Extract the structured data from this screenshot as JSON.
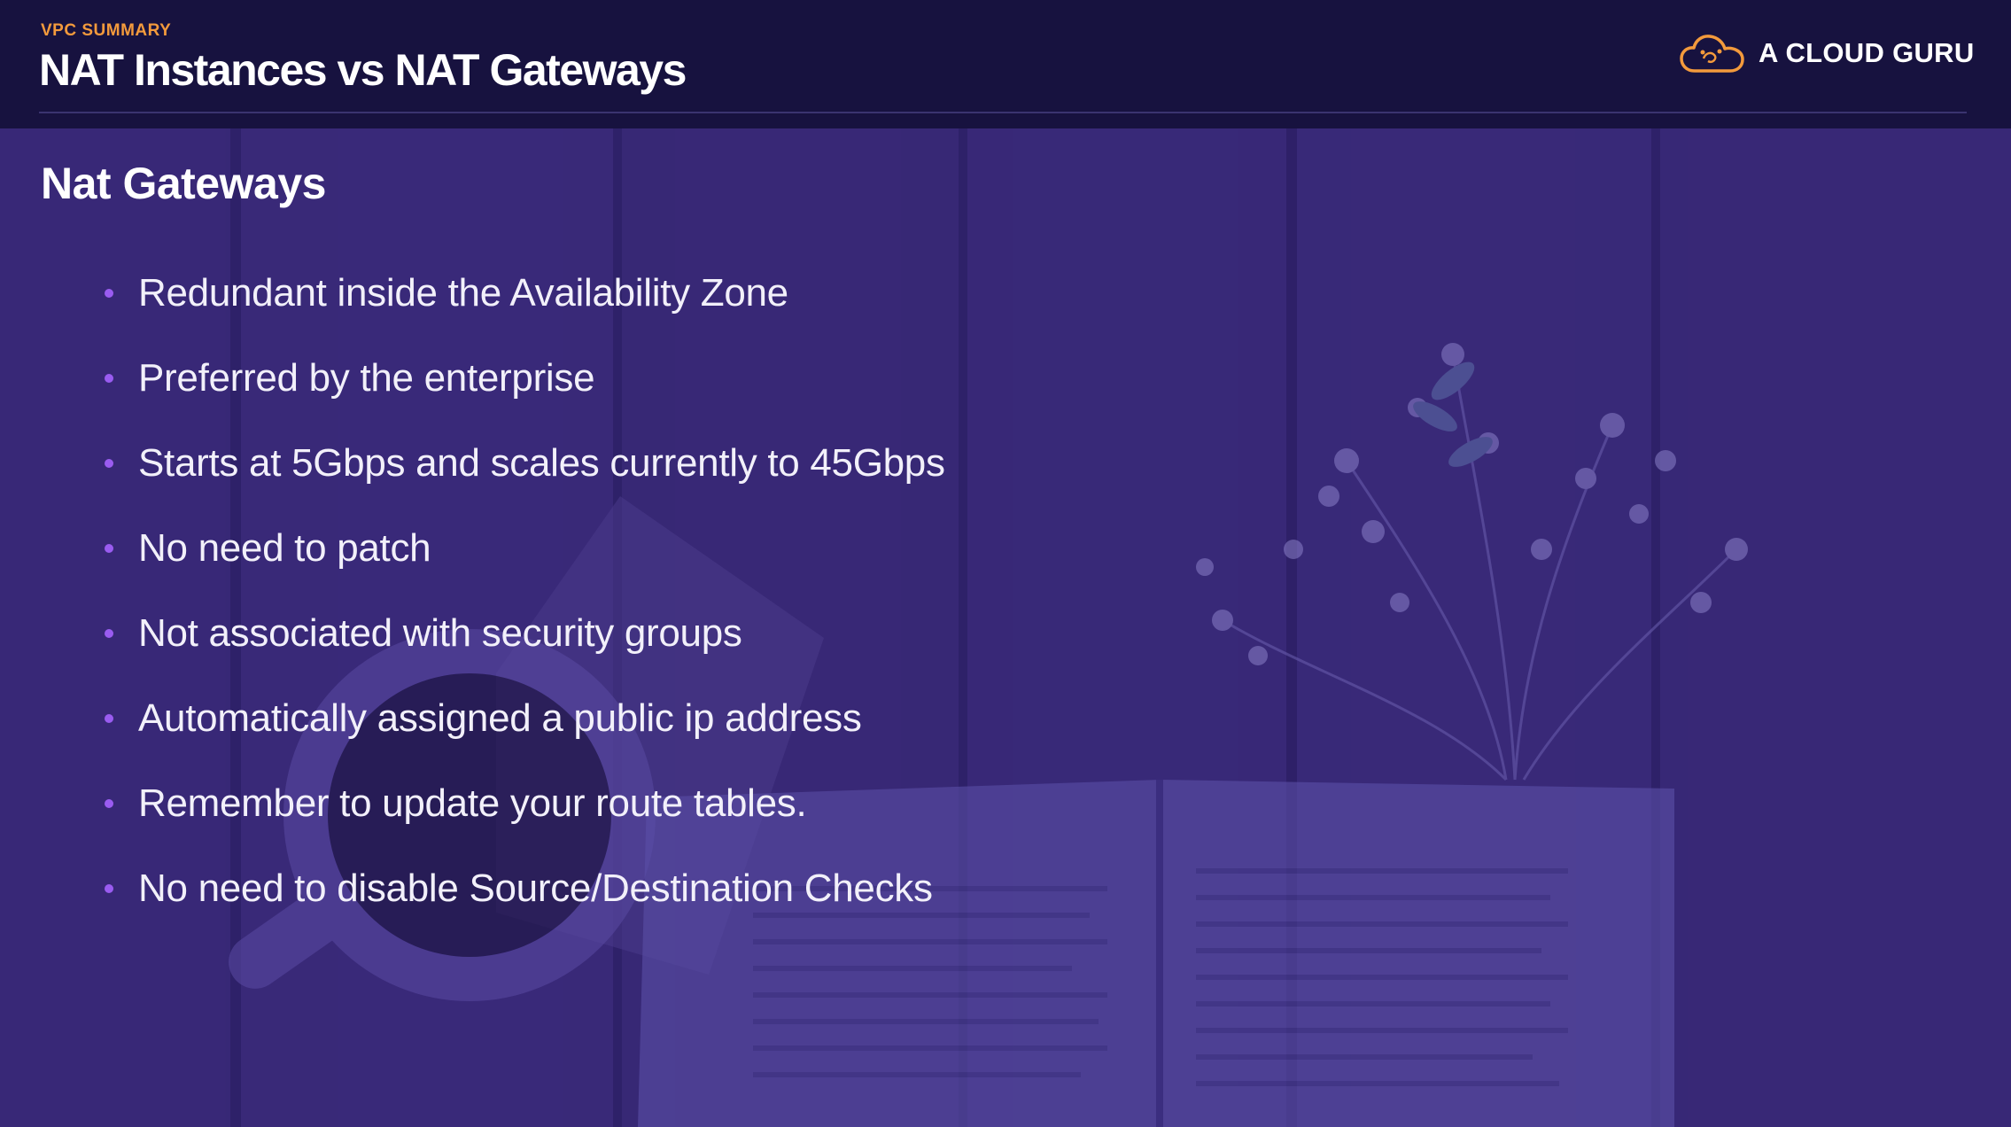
{
  "header": {
    "eyebrow": "VPC SUMMARY",
    "title": "NAT Instances vs NAT Gateways"
  },
  "logo": {
    "icon": "cloud-icon",
    "text": "A CLOUD GURU",
    "icon_color": "#f39a3c"
  },
  "content": {
    "heading": "Nat Gateways",
    "bullets": [
      "Redundant inside the Availability Zone",
      "Preferred by the enterprise",
      "Starts at 5Gbps and scales currently to 45Gbps",
      "No need to patch",
      "Not associated with security groups",
      "Automatically assigned a public ip address",
      "Remember to update your route tables.",
      "No need to disable Source/Destination Checks"
    ]
  },
  "colors": {
    "header_bg": "#17123f",
    "eyebrow": "#f39a3c",
    "bullet_dot": "#9a5cf0",
    "overlay": "#34247c"
  }
}
